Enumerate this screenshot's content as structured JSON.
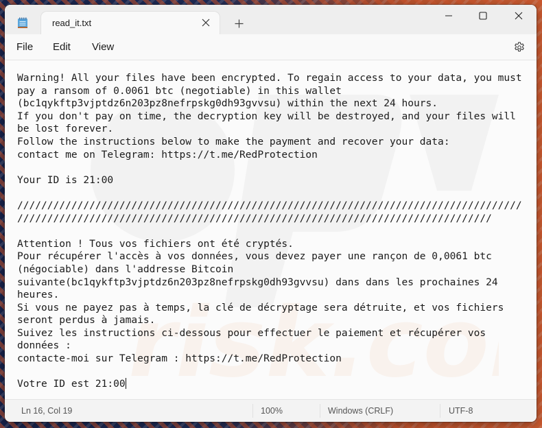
{
  "window": {
    "tab_title": "read_it.txt",
    "icons": {
      "app": "notepad-icon",
      "tab_close": "close-icon",
      "new_tab": "plus-icon",
      "minimize": "minimize-icon",
      "maximize": "maximize-icon",
      "close": "close-icon",
      "settings": "gear-icon"
    }
  },
  "menu": {
    "file": "File",
    "edit": "Edit",
    "view": "View"
  },
  "editor": {
    "lines": [
      "Warning! All your files have been encrypted. To regain access to your data, you must",
      "pay a ransom of 0.0061 btc (negotiable) in this wallet",
      "(bc1qykftp3vjptdz6n203pz8nefrpskg0dh93gvvsu) within the next 24 hours.",
      "If you don't pay on time, the decryption key will be destroyed, and your files will",
      "be lost forever.",
      "Follow the instructions below to make the payment and recover your data:",
      "contact me on Telegram: https://t.me/RedProtection",
      "",
      "Your ID is 21:00",
      "",
      "////////////////////////////////////////////////////////////////////////////////////",
      "///////////////////////////////////////////////////////////////////////////////",
      "",
      "Attention ! Tous vos fichiers ont été cryptés.",
      "Pour récupérer l'accès à vos données, vous devez payer une rançon de 0,0061 btc",
      "(négociable) dans l'addresse Bitcoin",
      "suivante(bc1qykftp3vjptdz6n203pz8nefrpskg0dh93gvvsu) dans dans les prochaines 24",
      "heures.",
      "Si vous ne payez pas à temps, la clé de décryptage sera détruite, et vos fichiers",
      "seront perdus à jamais.",
      "Suivez les instructions ci-dessous pour effectuer le paiement et récupérer vos",
      "données :",
      "contacte-moi sur Telegram : https://t.me/RedProtection",
      "",
      "Votre ID est 21:00"
    ]
  },
  "status": {
    "position": "Ln 16, Col 19",
    "zoom": "100%",
    "line_ending": "Windows (CRLF)",
    "encoding": "UTF-8"
  }
}
